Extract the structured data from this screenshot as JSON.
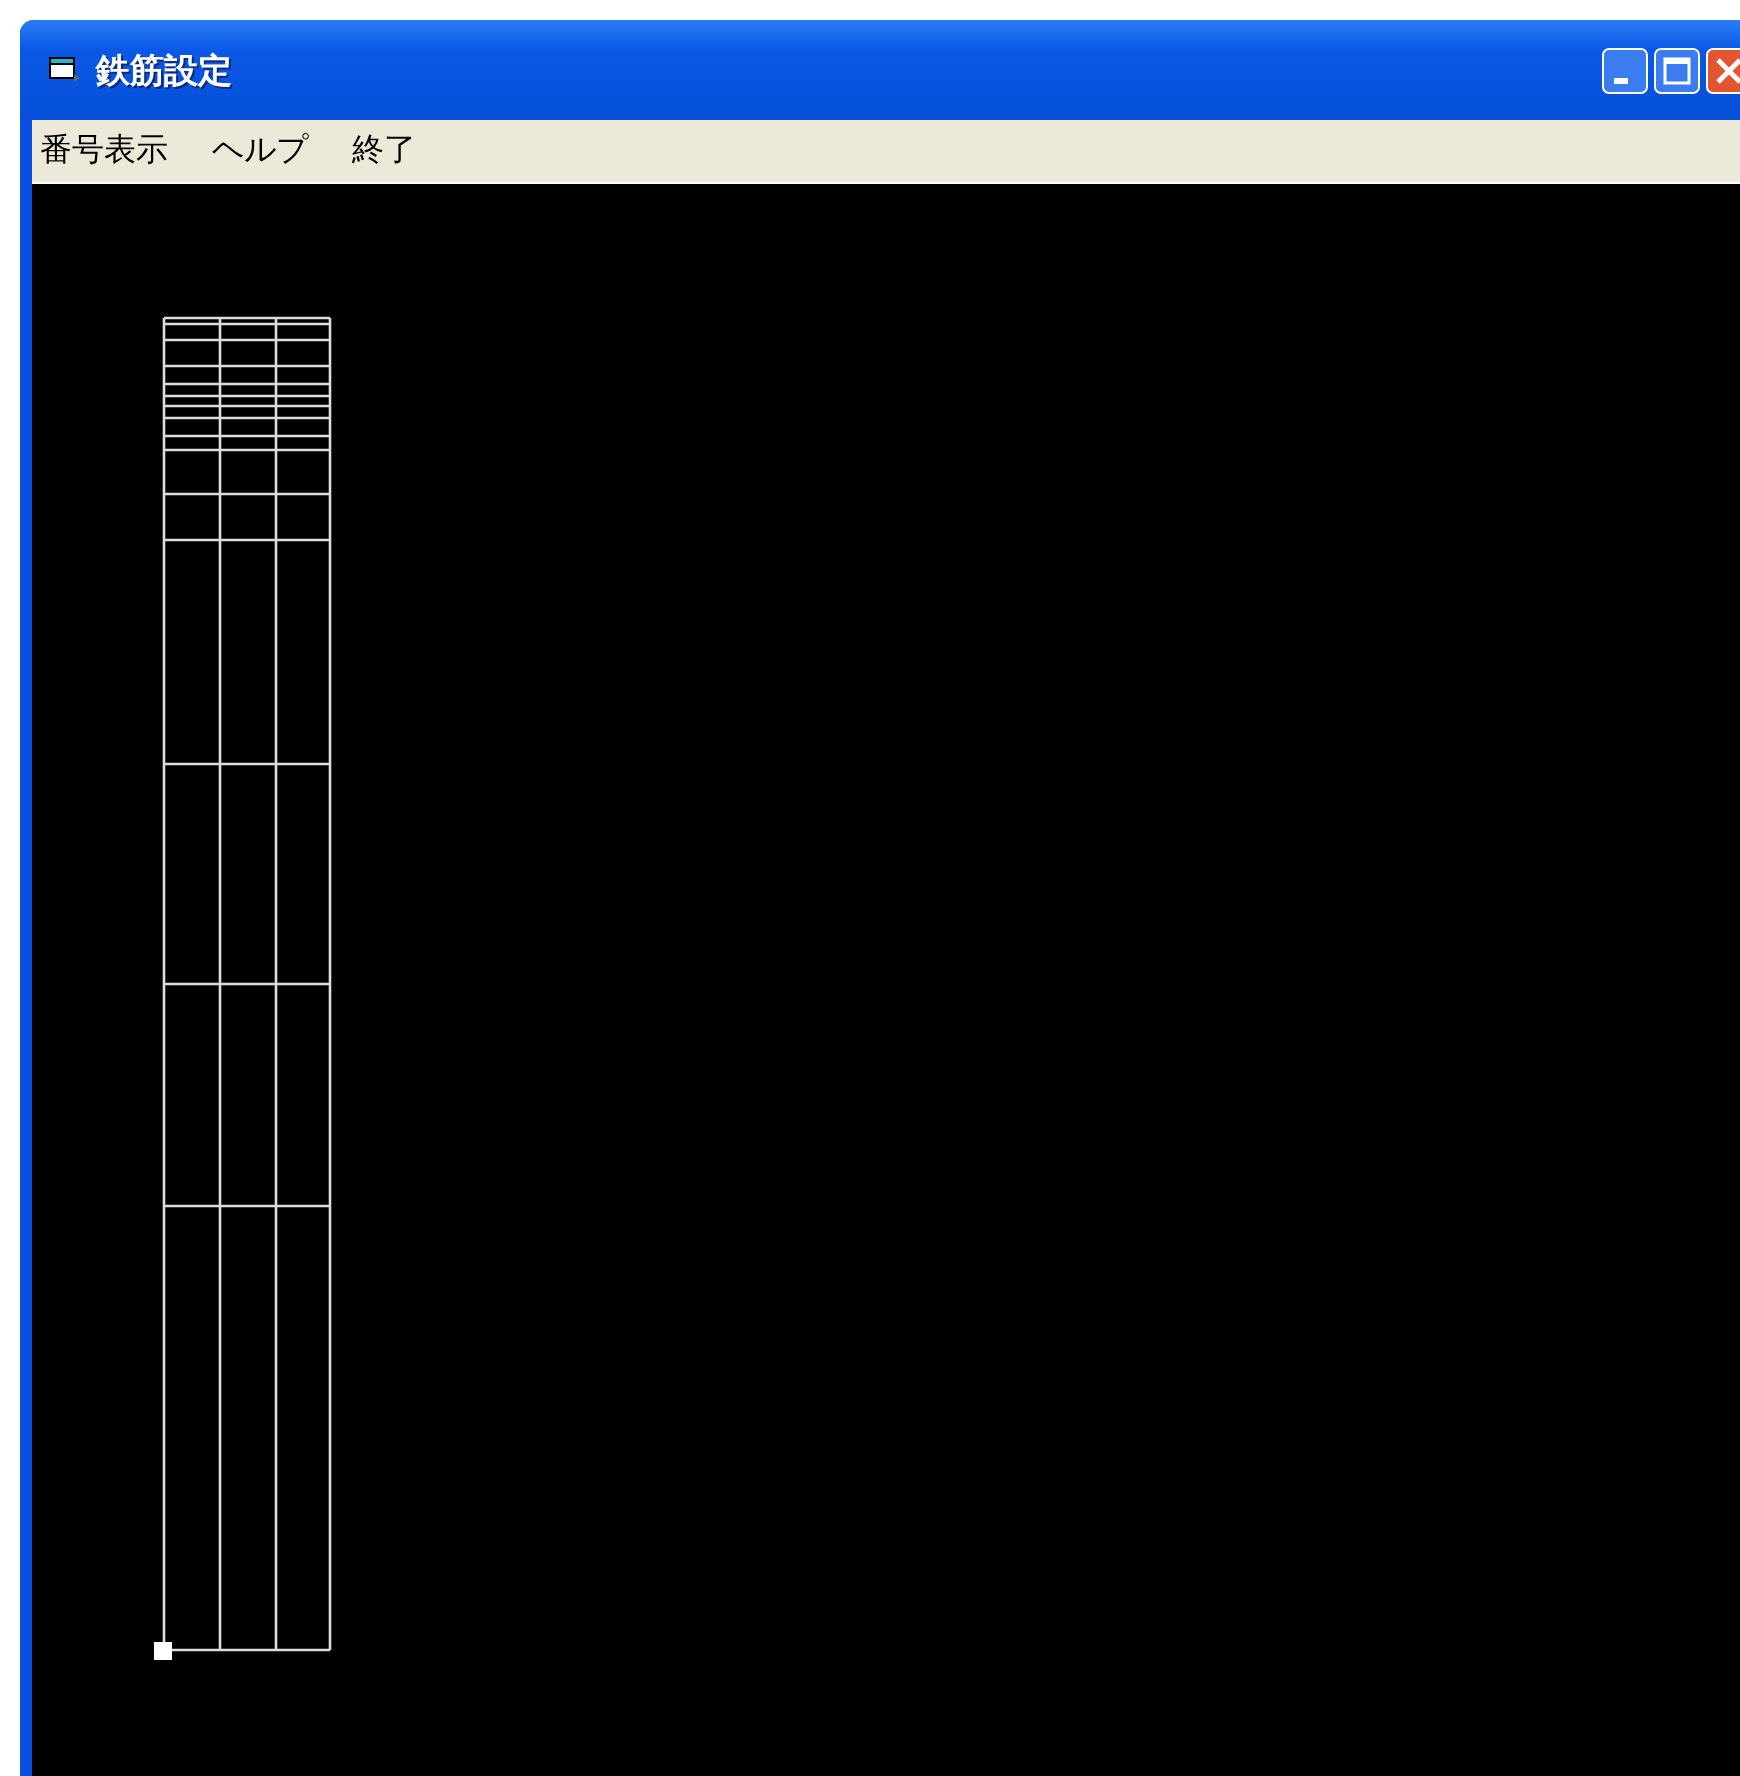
{
  "window": {
    "title": "鉄筋設定"
  },
  "menu": [
    {
      "label": "番号表示"
    },
    {
      "label": "ヘルプ"
    },
    {
      "label": "終了"
    }
  ]
}
